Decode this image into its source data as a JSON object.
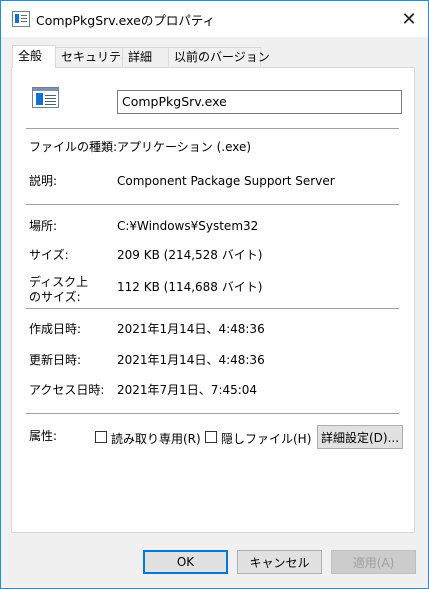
{
  "window": {
    "title": "CompPkgSrv.exeのプロパティ",
    "close_glyph": "✕"
  },
  "tabs": [
    {
      "label": "全般",
      "active": true
    },
    {
      "label": "セキュリティ",
      "active": false
    },
    {
      "label": "詳細",
      "active": false
    },
    {
      "label": "以前のバージョン",
      "active": false
    }
  ],
  "general": {
    "file_name": "CompPkgSrv.exe",
    "file_type_label": "ファイルの種類:",
    "file_type_value": "アプリケーション (.exe)",
    "description_label": "説明:",
    "description_value": "Component Package Support Server",
    "location_label": "場所:",
    "location_value": "C:¥Windows¥System32",
    "size_label": "サイズ:",
    "size_value": "209 KB (214,528 バイト)",
    "disk_size_label_1": "ディスク上",
    "disk_size_label_2": "のサイズ:",
    "disk_size_value": "112 KB (114,688 バイト)",
    "created_label": "作成日時:",
    "created_value": "2021年1月14日、4:48:36",
    "modified_label": "更新日時:",
    "modified_value": "2021年1月14日、4:48:36",
    "accessed_label": "アクセス日時:",
    "accessed_value": "2021年7月1日、7:45:04",
    "attributes_label": "属性:",
    "readonly_label": "読み取り専用(R)",
    "readonly_checked": false,
    "hidden_label": "隠しファイル(H)",
    "hidden_checked": false,
    "advanced_button": "詳細設定(D)..."
  },
  "footer": {
    "ok": "OK",
    "cancel": "キャンセル",
    "apply": "適用(A)"
  }
}
